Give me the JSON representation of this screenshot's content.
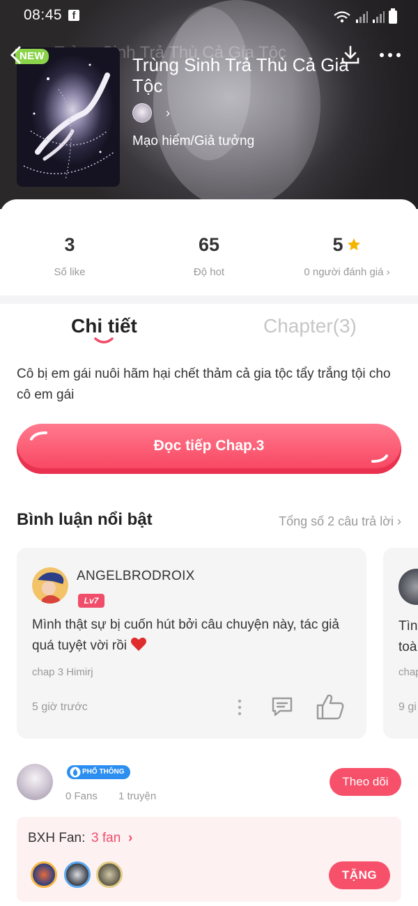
{
  "status_bar": {
    "time": "08:45",
    "facebook_glyph": "f"
  },
  "header": {
    "ghost_title": "Trùng Sinh Trả Thù Cả Gia Tộc",
    "new_badge": "NEW",
    "title": "Trùng Sinh Trả Thù Cả Gia Tộc",
    "author_chevron": "›",
    "genre": "Mạo hiểm/Giả tưởng"
  },
  "stats": {
    "likes": {
      "value": "3",
      "label": "Số like"
    },
    "hot": {
      "value": "65",
      "label": "Độ hot"
    },
    "rating": {
      "value": "5",
      "label": "0 người đánh giá ›"
    }
  },
  "tabs": {
    "detail": "Chi tiết",
    "chapter": "Chapter(3)"
  },
  "description": "Cô bị em gái nuôi hãm hại chết thảm cả gia tộc tẩy trắng tội cho cô em gái",
  "read_button": "Đọc tiếp Chap.3",
  "comments_section": {
    "title": "Bình luận nổi bật",
    "total": "Tổng số 2 câu trả lời  ›",
    "comments": [
      {
        "user": "ANGELBRODROIX",
        "level": "Lv7",
        "text": "Mình thật sự bị cuốn hút bởi câu chuyện này, tác giả quá tuyệt vời rồi",
        "chapter": "chap 3 Himirj",
        "time": "5 giờ trước"
      },
      {
        "text_line1": "Tìn",
        "text_line2": "toà",
        "chapter": "chap",
        "time": "9 gi"
      }
    ]
  },
  "author": {
    "rank": "PHỔ THÔNG",
    "fans": "0 Fans",
    "works": "1 truyện",
    "follow_button": "Theo dõi"
  },
  "fan_ranking": {
    "label": "BXH Fan:",
    "count": "3 fan",
    "chevron": "›",
    "donate_button": "TẶNG"
  },
  "colors": {
    "accent": "#f7506a",
    "new_badge": "#8bd34b",
    "star": "#f5b400"
  }
}
